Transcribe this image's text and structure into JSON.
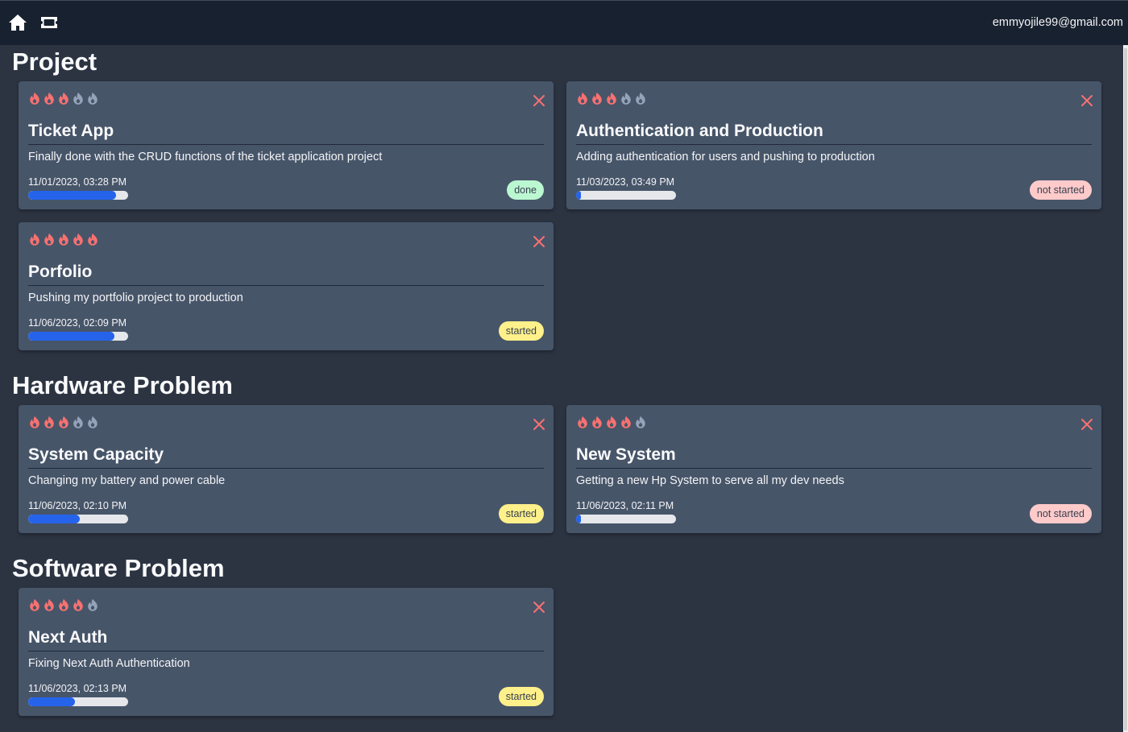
{
  "nav": {
    "home_icon": "home-icon",
    "ticket_icon": "ticket-icon",
    "user_email": "emmyojile99@gmail.com"
  },
  "colors": {
    "flame_active": "#f87171",
    "flame_inactive": "#94a3b8",
    "delete": "#f87171",
    "progress": "#2563eb",
    "status_done": "#bbf7d0",
    "status_started": "#fef08a",
    "status_not_started": "#fecaca"
  },
  "categories": [
    {
      "title": "Project",
      "tickets": [
        {
          "title": "Ticket App",
          "description": "Finally done with the CRUD functions of the ticket application project",
          "date": "11/01/2023, 03:28 PM",
          "priority": 3,
          "progress": 0.88,
          "status": "done"
        },
        {
          "title": "Authentication and Production",
          "description": "Adding authentication for users and pushing to production",
          "date": "11/03/2023, 03:49 PM",
          "priority": 3,
          "progress": 0.05,
          "status": "not started"
        },
        {
          "title": "Porfolio",
          "description": "Pushing my portfolio project to production",
          "date": "11/06/2023, 02:09 PM",
          "priority": 5,
          "progress": 0.86,
          "status": "started"
        }
      ]
    },
    {
      "title": "Hardware Problem",
      "tickets": [
        {
          "title": "System Capacity",
          "description": "Changing my battery and power cable",
          "date": "11/06/2023, 02:10 PM",
          "priority": 3,
          "progress": 0.52,
          "status": "started"
        },
        {
          "title": "New System",
          "description": "Getting a new Hp System to serve all my dev needs",
          "date": "11/06/2023, 02:11 PM",
          "priority": 4,
          "progress": 0.05,
          "status": "not started"
        }
      ]
    },
    {
      "title": "Software Problem",
      "tickets": [
        {
          "title": "Next Auth",
          "description": "Fixing Next Auth Authentication",
          "date": "11/06/2023, 02:13 PM",
          "priority": 4,
          "progress": 0.47,
          "status": "started"
        }
      ]
    }
  ]
}
